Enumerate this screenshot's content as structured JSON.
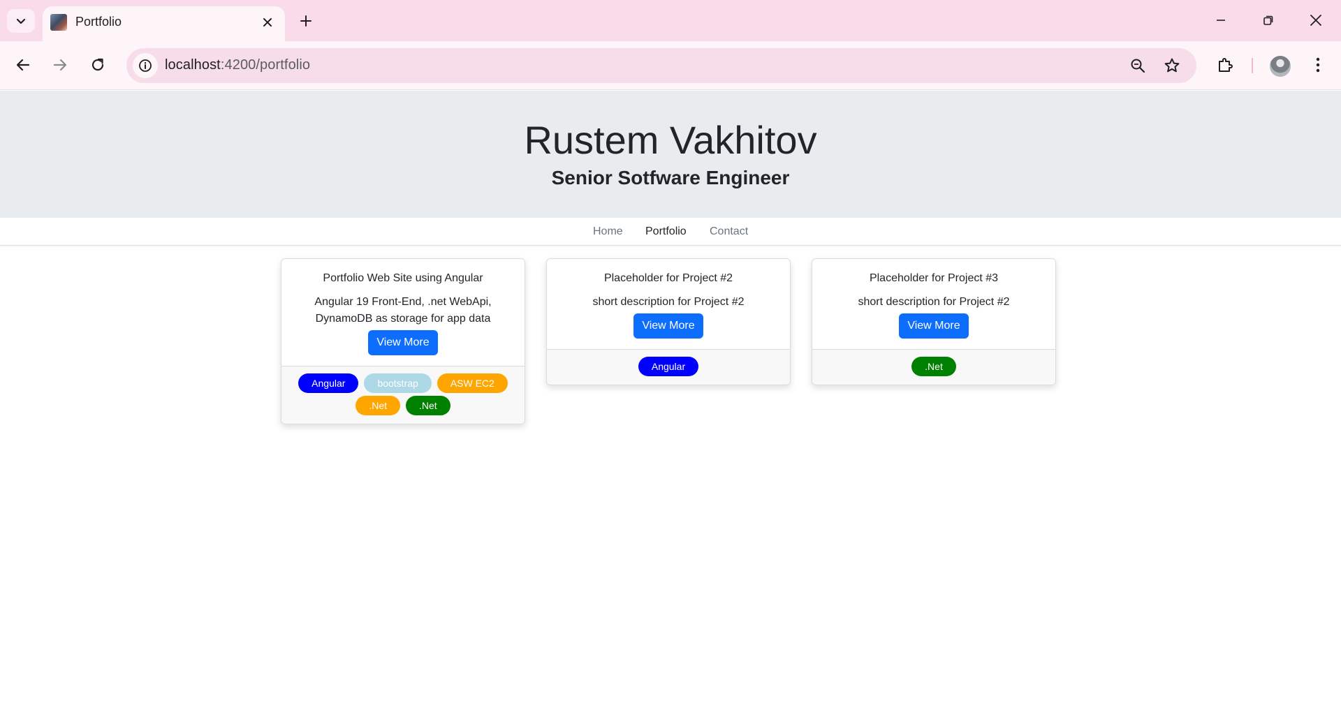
{
  "browser": {
    "tab_title": "Portfolio",
    "url_host": "localhost",
    "url_path": ":4200/portfolio",
    "icons": [
      "tab-search-icon",
      "close-icon",
      "plus-icon",
      "minimize-icon",
      "restore-icon",
      "close-window-icon",
      "back-icon",
      "forward-icon",
      "reload-icon",
      "info-icon",
      "zoom-icon",
      "star-icon",
      "extensions-icon",
      "menu-icon"
    ]
  },
  "header": {
    "name": "Rustem Vakhitov",
    "role": "Senior Sotfware Engineer"
  },
  "nav": {
    "home": "Home",
    "portfolio": "Portfolio",
    "contact": "Contact",
    "active": "Portfolio"
  },
  "cards": [
    {
      "title": "Portfolio Web Site using Angular",
      "description": "Angular 19 Front-End, .net WebApi, DynamoDB as storage for app data",
      "button": "View More",
      "tags": [
        {
          "label": "Angular",
          "bg": "#0000ff",
          "fg": "#ffffff"
        },
        {
          "label": "bootstrap",
          "bg": "#add8e6",
          "fg": "#ffffff"
        },
        {
          "label": "ASW EC2",
          "bg": "#ffa500",
          "fg": "#ffffff"
        },
        {
          "label": ".Net",
          "bg": "#ffa500",
          "fg": "#ffffff"
        },
        {
          "label": ".Net",
          "bg": "#008000",
          "fg": "#ffffff"
        }
      ]
    },
    {
      "title": "Placeholder for Project #2",
      "description": "short description for Project #2",
      "button": "View More",
      "tags": [
        {
          "label": "Angular",
          "bg": "#0000ff",
          "fg": "#ffffff"
        }
      ]
    },
    {
      "title": "Placeholder for Project #3",
      "description": "short description for Project #2",
      "button": "View More",
      "tags": [
        {
          "label": ".Net",
          "bg": "#008000",
          "fg": "#ffffff"
        }
      ]
    }
  ],
  "colors": {
    "primary": "#0d6efd",
    "hero_bg": "#e9ecef",
    "tabbar_bg": "#f9dbea"
  }
}
